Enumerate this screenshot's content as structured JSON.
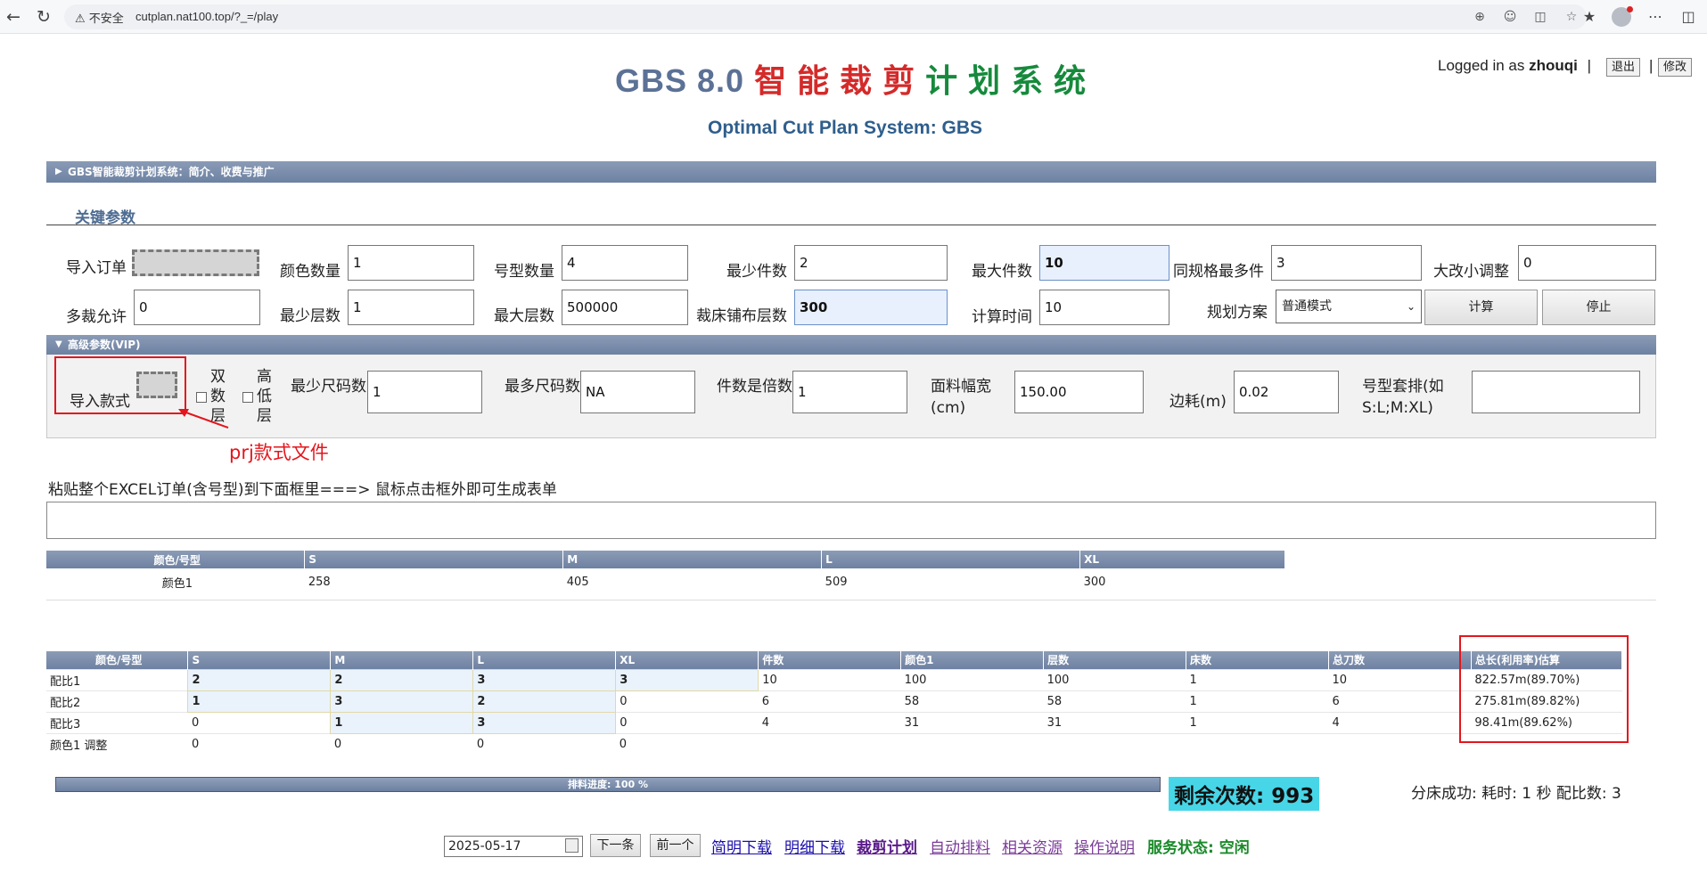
{
  "browser": {
    "security_label": "不安全",
    "url": "cutplan.nat100.top/?_=/play"
  },
  "header": {
    "title_part1": "GBS 8.0 ",
    "title_part2": "智 能 裁 剪 ",
    "title_part3": "计 划 系 统",
    "subtitle": "Optimal Cut Plan System: GBS",
    "login_prefix": "Logged in as ",
    "username": "zhouqi",
    "sep": "|",
    "logout_label": "退出",
    "modify_label": "修改"
  },
  "intro_bar": {
    "label": "GBS智能裁剪计划系统：简介、收费与推广"
  },
  "key_params": {
    "section_title": "关键参数",
    "import_order_label": "导入订单",
    "color_count_label": "颜色数量",
    "color_count": "1",
    "size_count_label": "号型数量",
    "size_count": "4",
    "min_pieces_label": "最少件数",
    "min_pieces": "2",
    "max_pieces_label": "最大件数",
    "max_pieces": "10",
    "same_spec_max_label": "同规格最多件",
    "same_spec_max": "3",
    "big_small_adjust_label": "大改小调整",
    "big_small_adjust": "0",
    "multi_cut_label": "多裁允许",
    "multi_cut": "0",
    "min_layers_label": "最少层数",
    "min_layers": "1",
    "max_layers_label": "最大层数",
    "max_layers": "500000",
    "bed_layers_label": "裁床铺布层数",
    "bed_layers": "300",
    "calc_time_label": "计算时间",
    "calc_time": "10",
    "plan_label": "规划方案",
    "plan_value": "普通模式",
    "calc_button": "计算",
    "stop_button": "停止"
  },
  "vip": {
    "bar_label": "高级参数(VIP)",
    "import_style_label": "导入款式",
    "double_layer_label": "双数层",
    "high_low_layer_label": "高低层",
    "min_size_count_label": "最少尺码数",
    "min_size_count": "1",
    "max_size_count_label": "最多尺码数",
    "max_size_count": "NA",
    "multiple_label": "件数是倍数",
    "multiple": "1",
    "fabric_width_label": "面料幅宽(cm)",
    "fabric_width": "150.00",
    "edge_loss_label": "边耗(m)",
    "edge_loss": "0.02",
    "size_nesting_label": "号型套排(如S:L;M:XL)",
    "size_nesting": "",
    "annotation": "prj款式文件"
  },
  "paste": {
    "label": "粘贴整个EXCEL订单(含号型)到下面框里===> 鼠标点击框外即可生成表单"
  },
  "order_table": {
    "headers": [
      "颜色/号型",
      "S",
      "M",
      "L",
      "XL"
    ],
    "rows": [
      [
        "颜色1",
        "258",
        "405",
        "509",
        "300"
      ]
    ]
  },
  "plan_table": {
    "headers": [
      "颜色/号型",
      "S",
      "M",
      "L",
      "XL",
      "件数",
      "颜色1",
      "层数",
      "床数",
      "总刀数",
      "总长(利用率)估算"
    ],
    "rows": [
      [
        "配比1",
        "2",
        "2",
        "3",
        "3",
        "10",
        "100",
        "100",
        "1",
        "10",
        "822.57m(89.70%)"
      ],
      [
        "配比2",
        "1",
        "3",
        "2",
        "0",
        "6",
        "58",
        "58",
        "1",
        "6",
        "275.81m(89.82%)"
      ],
      [
        "配比3",
        "0",
        "1",
        "3",
        "0",
        "4",
        "31",
        "31",
        "1",
        "4",
        "98.41m(89.62%)"
      ],
      [
        "颜色1 调整",
        "0",
        "0",
        "0",
        "0",
        "",
        "",
        "",
        "",
        "",
        ""
      ]
    ]
  },
  "footer": {
    "progress_label": "排料进度: 100 %",
    "progress_value": 1.0,
    "remain_label": "剩余次数: ",
    "remain_value": "993",
    "status_text": "分床成功: 耗时: 1 秒 配比数: 3",
    "date": "2025-05-17",
    "next_button": "下一条",
    "prev_button": "前一个",
    "links": [
      "简明下载",
      "明细下载",
      "裁剪计划",
      "自动排料",
      "相关资源",
      "操作说明"
    ],
    "service_status": "服务状态: 空闲"
  }
}
